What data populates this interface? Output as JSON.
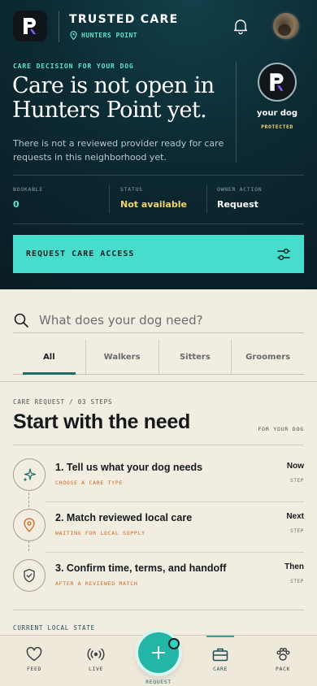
{
  "header": {
    "app_name": "TRUSTED CARE",
    "location": "HUNTERS POINT",
    "logo_icon": "paw-logo-icon",
    "bell_icon": "bell-icon",
    "avatar": "user-avatar"
  },
  "hero": {
    "eyebrow": "CARE DECISION FOR YOUR DOG",
    "headline": "Care is not open in Hunters Point yet.",
    "description": "There is not a reviewed provider ready for care requests in this neighborhood yet.",
    "dog_name": "your dog",
    "dog_status": "PROTECTED",
    "stats": [
      {
        "label": "BOOKABLE",
        "value": "0",
        "color": "#5ee4cc"
      },
      {
        "label": "STATUS",
        "value": "Not available",
        "color": "#f5d46b"
      },
      {
        "label": "OWNER ACTION",
        "value": "Request",
        "color": "#ffffff"
      }
    ],
    "cta_label": "REQUEST CARE ACCESS",
    "cta_icon": "sliders-icon"
  },
  "search": {
    "placeholder": "What does your dog need?",
    "value": ""
  },
  "tabs": [
    {
      "label": "All",
      "active": true
    },
    {
      "label": "Walkers",
      "active": false
    },
    {
      "label": "Sitters",
      "active": false
    },
    {
      "label": "Groomers",
      "active": false
    }
  ],
  "care_request": {
    "eyebrow": "CARE REQUEST / 03 STEPS",
    "title": "Start with the need",
    "side_label": "FOR YOUR DOG",
    "steps": [
      {
        "title": "1. Tell us what your dog needs",
        "subtitle": "CHOOSE A CARE TYPE",
        "when": "Now",
        "step_label": "STEP",
        "icon": "sparkle-icon"
      },
      {
        "title": "2. Match reviewed local care",
        "subtitle": "WAITING FOR LOCAL SUPPLY",
        "when": "Next",
        "step_label": "STEP",
        "icon": "map-pin-icon"
      },
      {
        "title": "3. Confirm time, terms, and handoff",
        "subtitle": "AFTER A REVIEWED MATCH",
        "when": "Then",
        "step_label": "STEP",
        "icon": "shield-check-icon"
      }
    ],
    "local_state_label": "CURRENT LOCAL STATE"
  },
  "nav": {
    "items": [
      {
        "label": "FEED",
        "icon": "heart-icon"
      },
      {
        "label": "LIVE",
        "icon": "broadcast-icon"
      },
      {
        "label": "CARE",
        "icon": "briefcase-icon",
        "active": true
      },
      {
        "label": "PACK",
        "icon": "paw-icon"
      }
    ],
    "fab_label": "REQUEST",
    "fab_icon": "plus-icon"
  },
  "colors": {
    "hero_bg": "#0c2a33",
    "accent": "#46ddcc",
    "warning": "#f5d46b",
    "step_orange": "#d1661d",
    "page_bg": "#f2ede1"
  }
}
